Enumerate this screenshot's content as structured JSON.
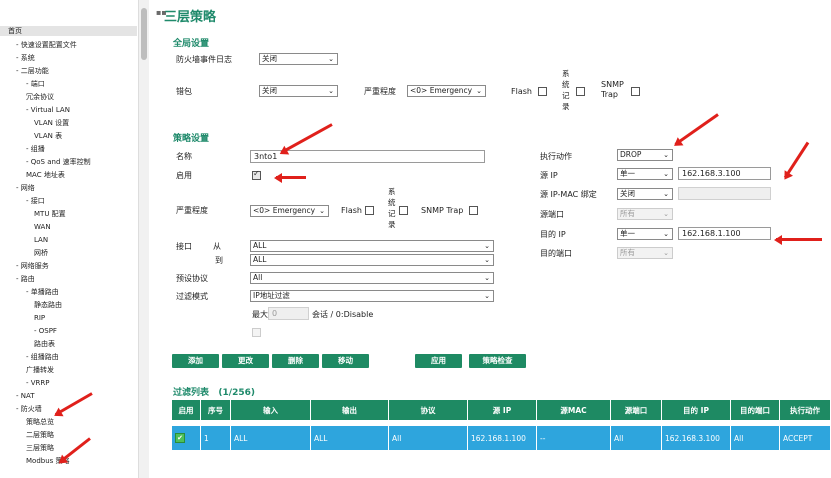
{
  "sidebar": {
    "items": [
      "首页",
      "- 快速设置配置文件",
      "- 系统",
      "- 二层功能",
      "- 端口",
      "冗余协议",
      "- Virtual LAN",
      "VLAN 设置",
      "VLAN 表",
      "- 组播",
      "- QoS and 速率控制",
      "MAC 地址表",
      "- 网络",
      "- 接口",
      "MTU 配置",
      "WAN",
      "LAN",
      "网桥",
      "- 网络服务",
      "- 路由",
      "- 单播路由",
      "静态路由",
      "RIP",
      "- OSPF",
      "路由表",
      "- 组播路由",
      "广播转发",
      "- VRRP",
      "- NAT",
      "- 防火墙",
      "策略总览",
      "二层策略",
      "三层策略",
      "Modbus 策略"
    ]
  },
  "page": {
    "title": "三层策略"
  },
  "global": {
    "section": "全局设置",
    "log_label": "防火墙事件日志",
    "log_value": "关闭",
    "malformed_label": "错包",
    "malformed_value": "关闭",
    "severity_label": "严重程度",
    "severity_value": "<0> Emergency",
    "flash_label": "Flash",
    "syslog_label": "系统记录",
    "snmp_label": "SNMP Trap"
  },
  "policy": {
    "section": "策略设置",
    "name_label": "名称",
    "name_value": "3nto1",
    "enable_label": "启用",
    "severity_label": "严重程度",
    "severity_value": "<0> Emergency",
    "flash_label": "Flash",
    "syslog_label": "系统记录",
    "snmp_label": "SNMP Trap",
    "interface_label": "接口",
    "from_label": "从",
    "to_label": "到",
    "from_value": "ALL",
    "to_value": "ALL",
    "protocol_label": "预设协议",
    "protocol_value": "All",
    "filter_label": "过滤模式",
    "filter_value": "IP地址过滤",
    "max_label": "最大",
    "max_value": "0",
    "max_suffix": "会话 / 0:Disable",
    "action_label": "执行动作",
    "action_value": "DROP",
    "src_ip_label": "源 IP",
    "src_ip_mode": "单一",
    "src_ip_value": "162.168.3.100",
    "src_mac_label": "源 IP-MAC 绑定",
    "src_mac_mode": "关闭",
    "src_port_label": "源端口",
    "src_port_value": "所有",
    "dst_ip_label": "目的 IP",
    "dst_ip_mode": "单一",
    "dst_ip_value": "162.168.1.100",
    "dst_port_label": "目的端口",
    "dst_port_value": "所有"
  },
  "buttons": {
    "add": "添加",
    "modify": "更改",
    "delete": "删除",
    "move": "移动",
    "apply": "应用",
    "check": "策略检查"
  },
  "list": {
    "title": "过滤列表",
    "count": "(1/256)",
    "headers": [
      "启用",
      "序号",
      "输入",
      "输出",
      "协议",
      "源 IP",
      "源MAC",
      "源端口",
      "目的 IP",
      "目的端口",
      "执行动作"
    ],
    "rows": [
      {
        "enabled_icon": "check-icon",
        "cells": [
          "1",
          "ALL",
          "ALL",
          "All",
          "162.168.1.100",
          "--",
          "All",
          "162.168.3.100",
          "All",
          "ACCEPT"
        ]
      }
    ]
  },
  "colors": {
    "accent": "#1e8a63",
    "row_highlight": "#2ea5dd",
    "annotation": "#e0201b"
  }
}
